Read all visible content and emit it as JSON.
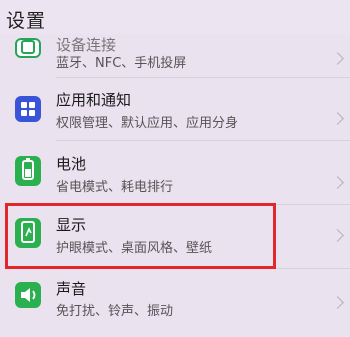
{
  "header": {
    "title": "设置"
  },
  "rows": [
    {
      "title": "设备连接",
      "subtitle": "蓝牙、NFC、手机投屏",
      "icon": "device-connect-icon"
    },
    {
      "title": "应用和通知",
      "subtitle": "权限管理、默认应用、应用分身",
      "icon": "apps-icon"
    },
    {
      "title": "电池",
      "subtitle": "省电模式、耗电排行",
      "icon": "battery-icon"
    },
    {
      "title": "显示",
      "subtitle": "护眼模式、桌面风格、壁纸",
      "icon": "display-icon"
    },
    {
      "title": "声音",
      "subtitle": "免打扰、铃声、振动",
      "icon": "sound-icon"
    }
  ],
  "colors": {
    "background": "#ebe2f0",
    "highlight": "#e3262d",
    "blue_icon": "#3a54d8",
    "green_icon": "#26a65b"
  }
}
